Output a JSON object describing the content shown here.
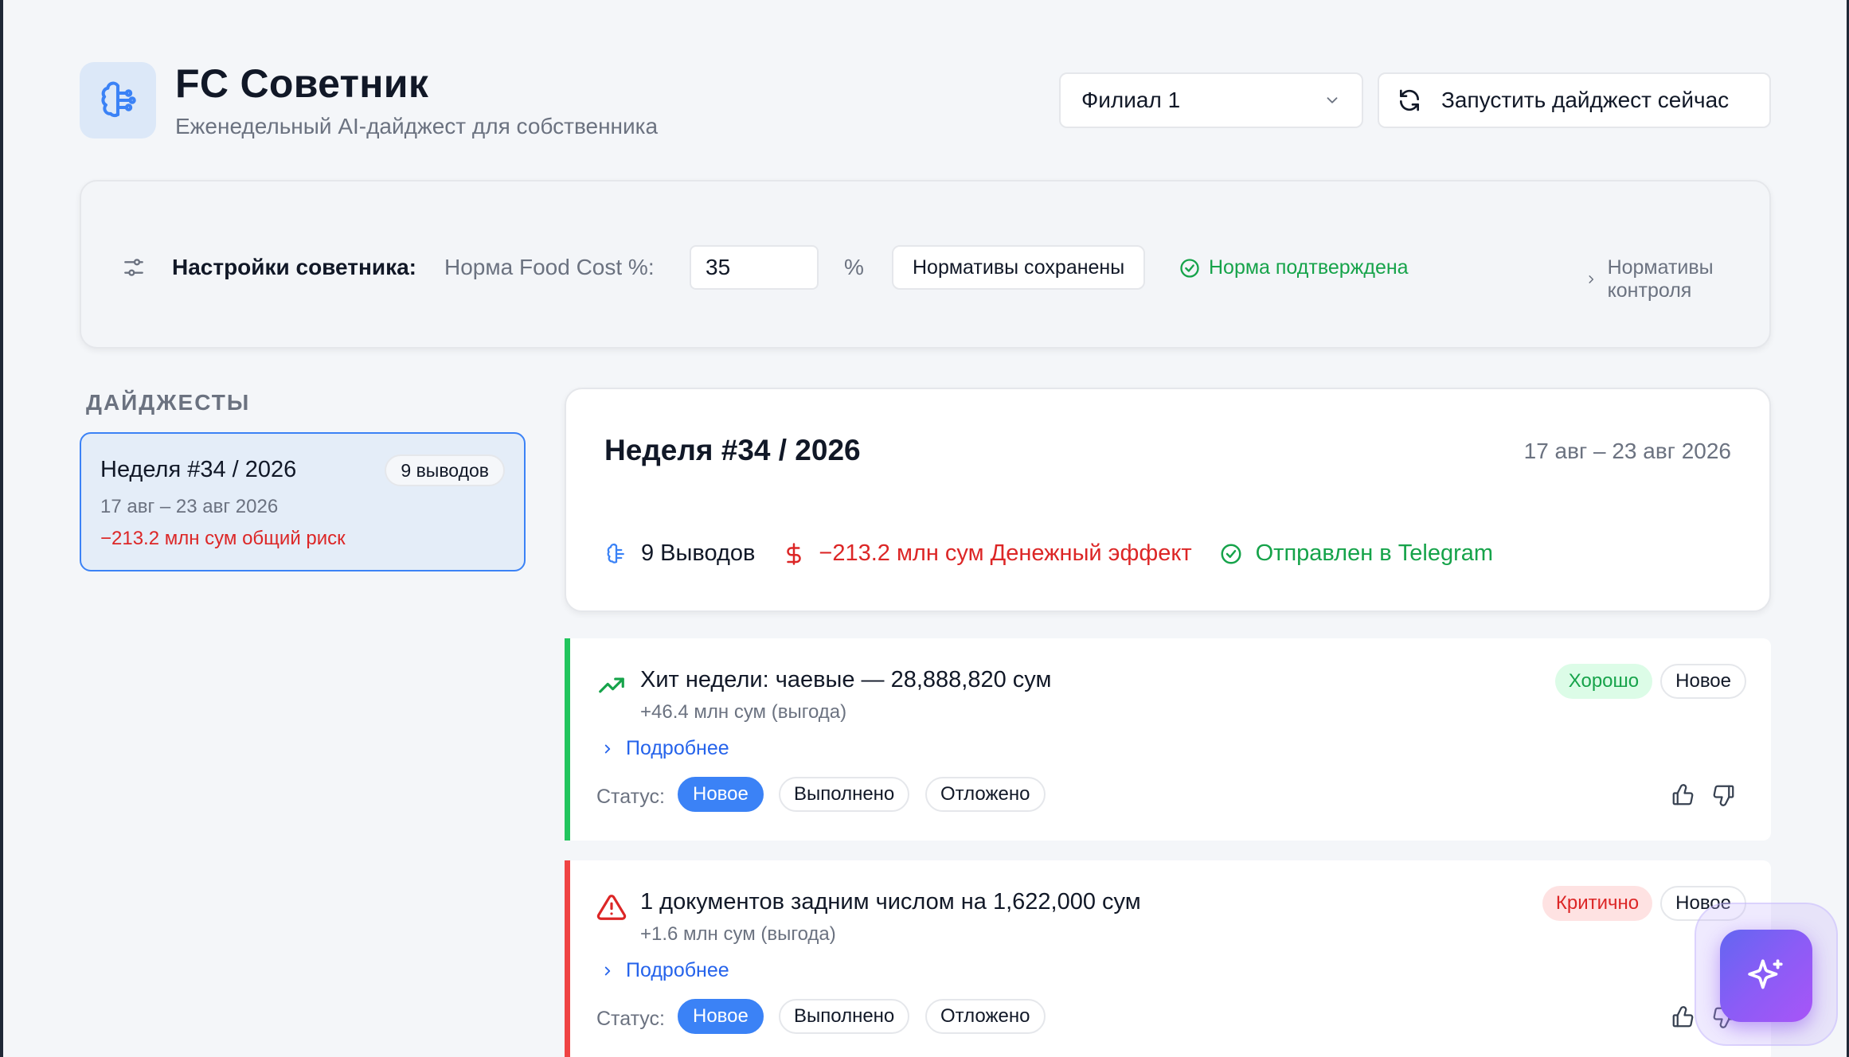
{
  "header": {
    "title": "FC Советник",
    "subtitle": "Еженедельный AI-дайджест для собственника",
    "logo_icon": "brain-icon",
    "branch_select_value": "Филиал 1",
    "run_button_label": "Запустить дайджест сейчас"
  },
  "settings": {
    "label": "Настройки советника:",
    "food_cost_label": "Норма Food Cost %:",
    "food_cost_value": "35",
    "percent_sign": "%",
    "saved_button_label": "Нормативы сохранены",
    "confirmed_label": "Норма подтверждена",
    "norms_link_label": "Нормативы контроля"
  },
  "digests": {
    "heading": "ДАЙДЖЕСТЫ",
    "items": [
      {
        "title": "Неделя #34 / 2026",
        "badge": "9 выводов",
        "dates": "17 авг – 23 авг 2026",
        "risk": "−213.2 млн сум общий риск"
      }
    ]
  },
  "week": {
    "title": "Неделя #34 / 2026",
    "dates": "17 авг – 23 авг 2026",
    "conclusions": "9 Выводов",
    "money_effect": "−213.2 млн сум Денежный эффект",
    "telegram_status": "Отправлен в Telegram"
  },
  "insights": [
    {
      "title": "Хит недели: чаевые — 28,888,820 сум",
      "subtitle": "+46.4 млн сум (выгода)",
      "more_label": "Подробнее",
      "severity": "Хорошо",
      "state_tag": "Новое",
      "status_label": "Статус:",
      "status_options": [
        "Новое",
        "Выполнено",
        "Отложено"
      ],
      "selected_status": "Новое",
      "icon": "trending-up-icon"
    },
    {
      "title": "1 документов задним числом на 1,622,000 сум",
      "subtitle": "+1.6 млн сум (выгода)",
      "more_label": "Подробнее",
      "severity": "Критично",
      "state_tag": "Новое",
      "status_label": "Статус:",
      "status_options": [
        "Новое",
        "Выполнено",
        "Отложено"
      ],
      "selected_status": "Новое",
      "icon": "warning-triangle-icon"
    }
  ],
  "colors": {
    "accent": "#3b82f6",
    "good": "#22c55e",
    "critical": "#ef4444",
    "link": "#2563eb"
  }
}
